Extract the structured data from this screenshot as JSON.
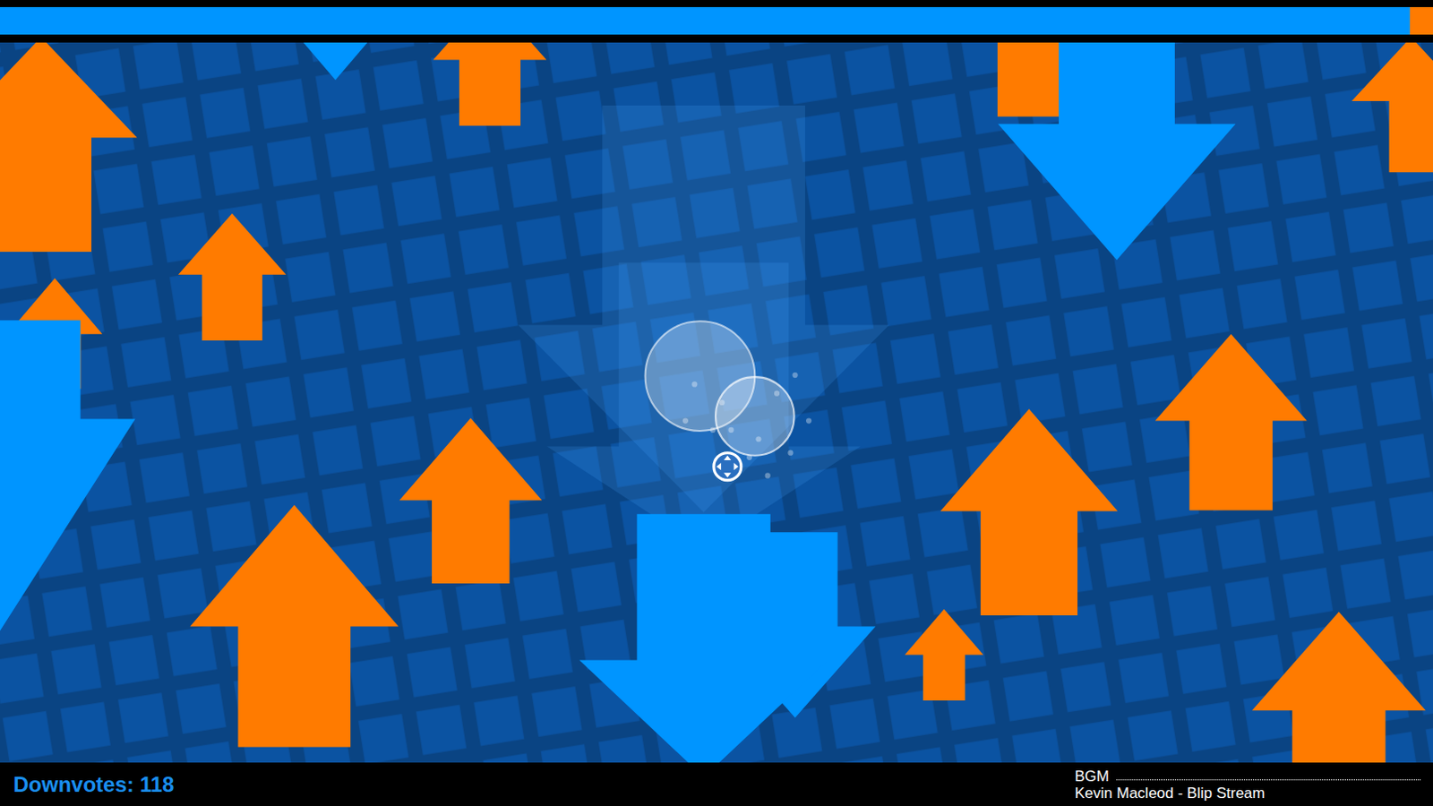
{
  "progress": {
    "level": 0.984
  },
  "score": {
    "text": "Downvotes: 118"
  },
  "music": {
    "label": "BGM",
    "track": "Kevin Macleod - Blip Stream"
  },
  "arrows": [
    {
      "kind": "ghost"
    },
    {
      "kind": "ghost"
    },
    {
      "kind": "up"
    },
    {
      "kind": "up"
    },
    {
      "kind": "up"
    },
    {
      "kind": "up"
    },
    {
      "kind": "up"
    },
    {
      "kind": "up"
    },
    {
      "kind": "up"
    },
    {
      "kind": "up"
    },
    {
      "kind": "up"
    },
    {
      "kind": "up"
    },
    {
      "kind": "up"
    },
    {
      "kind": "up"
    },
    {
      "kind": "down"
    },
    {
      "kind": "down"
    },
    {
      "kind": "down"
    },
    {
      "kind": "down"
    },
    {
      "kind": "down"
    }
  ]
}
